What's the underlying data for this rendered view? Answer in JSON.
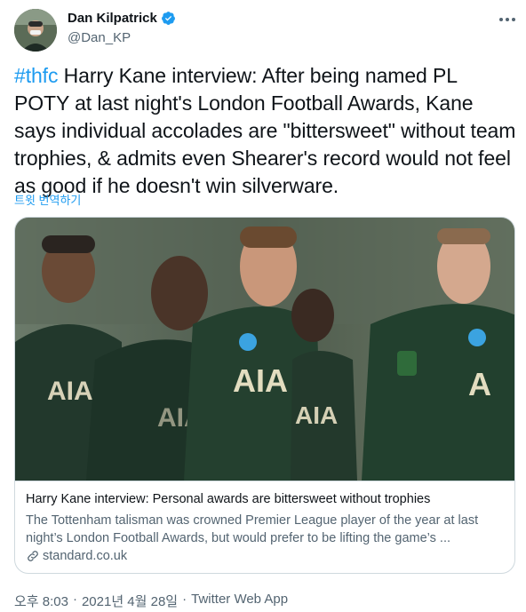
{
  "author": {
    "display_name": "Dan Kilpatrick",
    "handle": "@Dan_KP",
    "verified": true
  },
  "tweet": {
    "hashtag": "#thfc",
    "text": " Harry Kane interview: After being named PL POTY at last night's London Football Awards, Kane says individual accolades are \"bittersweet\" without team trophies, & admits even Shearer's record would not feel as good if he doesn't win silverware.",
    "translate_label": "트윗 번역하기"
  },
  "card": {
    "title": "Harry Kane interview: Personal awards are bittersweet without trophies",
    "description": "The Tottenham talisman was crowned Premier League player of the year at last night’s London Football Awards, but would prefer to be lifting the game’s ...",
    "domain": "standard.co.uk",
    "image_alt": "Tottenham players in dark green AIA kits"
  },
  "meta": {
    "time": "오후 8:03",
    "separator1": "·",
    "date": "2021년 4월 28일",
    "separator2": "·",
    "source": "Twitter Web App"
  },
  "colors": {
    "link": "#1d9bf0",
    "text": "#0f1419",
    "secondary": "#536471",
    "border": "#cfd9de",
    "kit_green": "#1f3a2c"
  }
}
